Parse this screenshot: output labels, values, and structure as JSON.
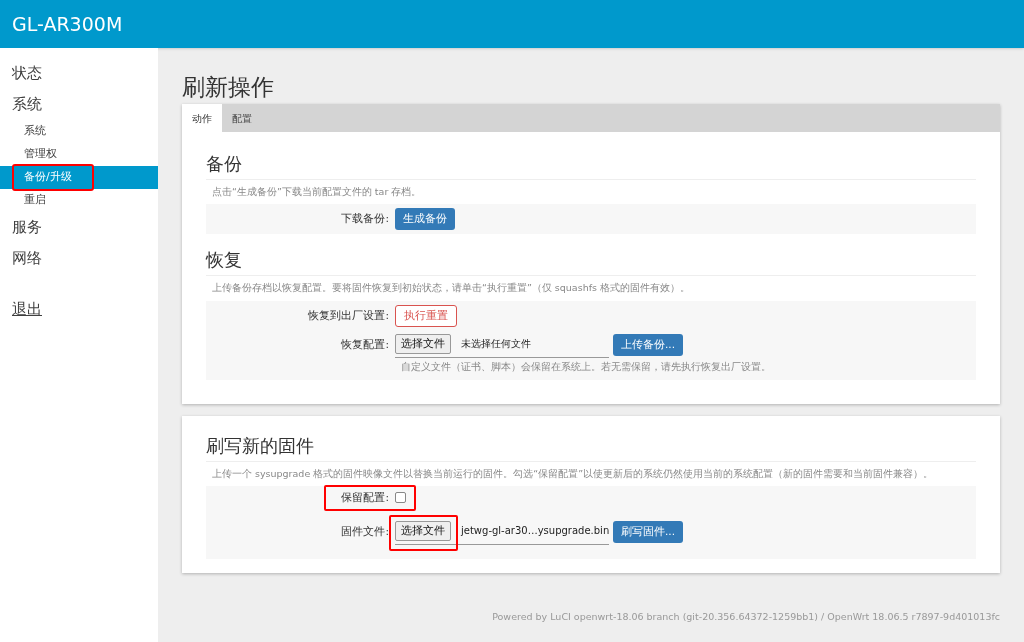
{
  "header": {
    "title": "GL-AR300M"
  },
  "sidebar": {
    "items": [
      {
        "label": "状态",
        "selected": false,
        "highlighted": false
      },
      {
        "label": "系统",
        "selected": false,
        "highlighted": false,
        "children": [
          {
            "label": "系统",
            "selected": false,
            "highlighted": false
          },
          {
            "label": "管理权",
            "selected": false,
            "highlighted": false
          },
          {
            "label": "备份/升级",
            "selected": true,
            "highlighted": true
          },
          {
            "label": "重启",
            "selected": false,
            "highlighted": false
          }
        ]
      },
      {
        "label": "服务",
        "selected": false,
        "highlighted": false
      },
      {
        "label": "网络",
        "selected": false,
        "highlighted": false
      }
    ],
    "logout": "退出"
  },
  "page_title": "刷新操作",
  "tabs": [
    {
      "label": "动作",
      "selected": true
    },
    {
      "label": "配置",
      "selected": false
    }
  ],
  "backup": {
    "title": "备份",
    "description": "点击“生成备份”下载当前配置文件的 tar 存档。",
    "label": "下载备份:",
    "button": "生成备份"
  },
  "restore": {
    "title": "恢复",
    "description": "上传备份存档以恢复配置。要将固件恢复到初始状态，请单击“执行重置”（仅 squashfs 格式的固件有效）。",
    "reset_label": "恢复到出厂设置:",
    "reset_button": "执行重置",
    "restore_label": "恢复配置:",
    "choose_button": "选择文件",
    "file_value": "未选择任何文件",
    "upload_button": "上传备份...",
    "hint": "自定义文件（证书、脚本）会保留在系统上。若无需保留，请先执行恢复出厂设置。"
  },
  "flash": {
    "title": "刷写新的固件",
    "description": "上传一个 sysupgrade 格式的固件映像文件以替换当前运行的固件。勾选“保留配置”以使更新后的系统仍然使用当前的系统配置（新的固件需要和当前固件兼容）。",
    "keep_label": "保留配置:",
    "keep_checked": false,
    "keep_highlighted": true,
    "file_label": "固件文件:",
    "choose_button": "选择文件",
    "choose_highlighted": true,
    "file_value": "jetwg-gl-ar30…ysupgrade.bin",
    "flash_button": "刷写固件..."
  },
  "footer": "Powered by LuCI openwrt-18.06 branch (git-20.356.64372-1259bb1) / OpenWrt 18.06.5 r7897-9d401013fc"
}
